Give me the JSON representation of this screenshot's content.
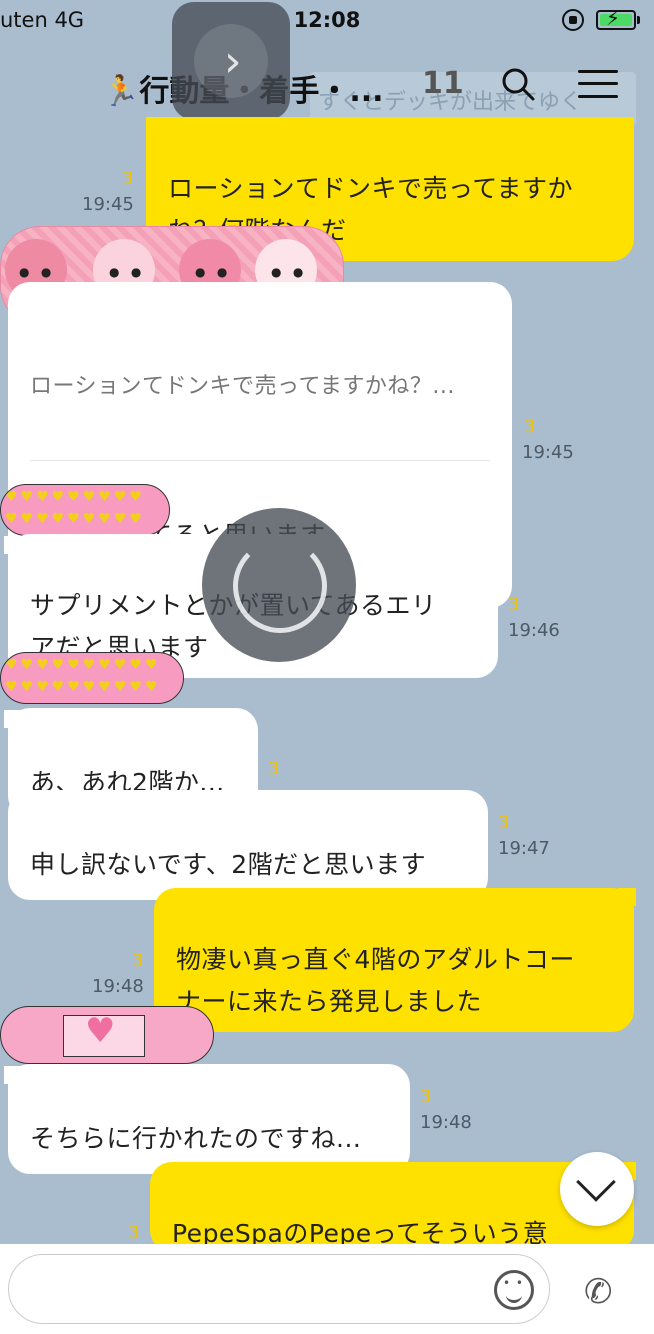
{
  "status_bar": {
    "carrier": "uten   4G",
    "time": "12:08"
  },
  "header": {
    "title": "🏃行動量・着手・...",
    "member_count": "11",
    "notice_text": "すくとデッキが出来てゆく"
  },
  "messages": [
    {
      "id": "m1",
      "side": "out",
      "text": "ローションてドンキで売ってますか\nね？何階なんだ",
      "read": "3",
      "time": "19:45"
    },
    {
      "id": "m2",
      "side": "in",
      "quote": "ローションてドンキで売ってますかね？...",
      "text": "3回に売ってると思います",
      "read": "3",
      "time": "19:45"
    },
    {
      "id": "m3",
      "side": "in",
      "text": "サプリメントとかが置いてあるエリ\nアだと思います",
      "read": "3",
      "time": "19:46"
    },
    {
      "id": "m4",
      "side": "in",
      "text": "あ、あれ2階か...",
      "read": "3",
      "time": ""
    },
    {
      "id": "m5",
      "side": "in",
      "text": "申し訳ないです、2階だと思います",
      "read": "3",
      "time": "19:47"
    },
    {
      "id": "m6",
      "side": "out",
      "text": "物凄い真っ直ぐ4階のアダルトコー\nナーに来たら発見しました",
      "read": "3",
      "time": "19:48"
    },
    {
      "id": "m7",
      "side": "in",
      "text": "そちらに行かれたのですね...",
      "read": "3",
      "time": "19:48"
    },
    {
      "id": "m8",
      "side": "out",
      "text": "PepeSpaのPepeってそういう意\nのかなと",
      "read": "3",
      "time": ""
    }
  ],
  "input": {
    "placeholder": ""
  },
  "colors": {
    "background": "#a9bdcf",
    "outgoing_bubble": "#ffe100",
    "incoming_bubble": "#ffffff",
    "read_mark": "#f2c200"
  },
  "icons": {
    "search": "search-icon",
    "menu": "hamburger-menu-icon",
    "emoji": "emoji-icon",
    "call": "phone-icon",
    "scroll_down": "chevron-down-icon"
  }
}
